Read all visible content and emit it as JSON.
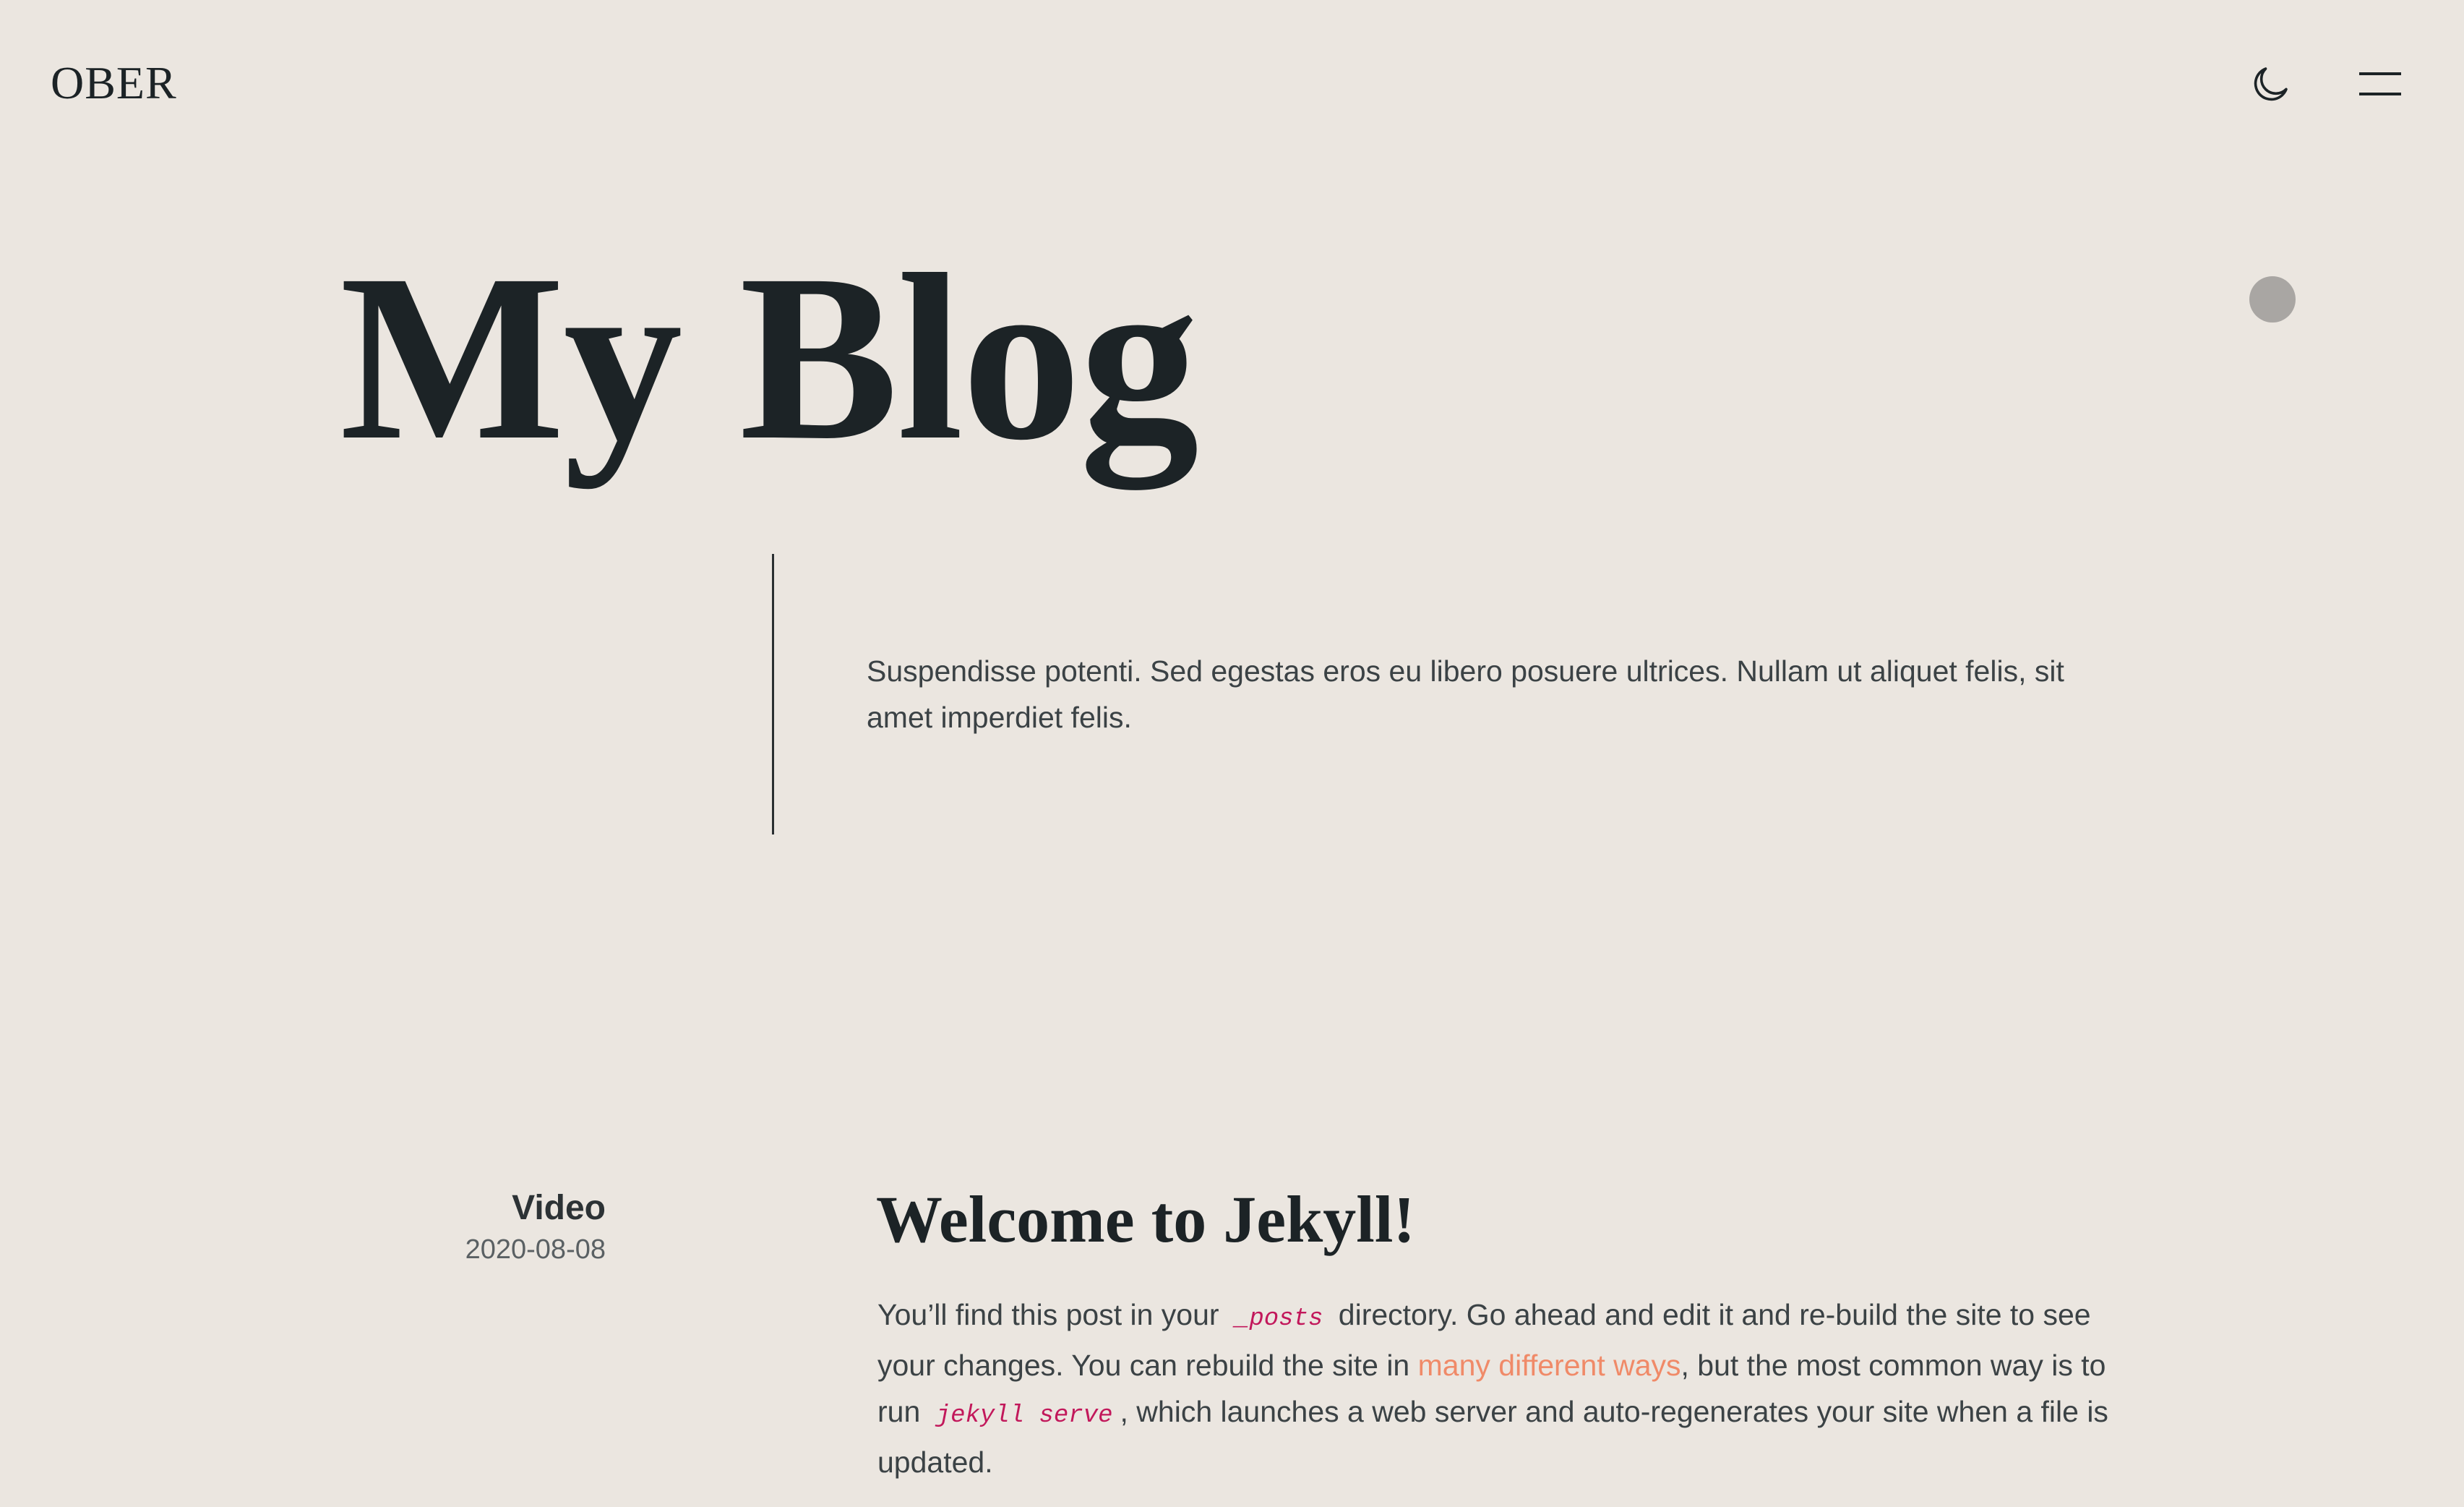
{
  "header": {
    "logo": "OBER",
    "theme_icon": "moon-icon",
    "menu_icon": "hamburger-menu-icon"
  },
  "hero": {
    "title": "My Blog",
    "intro": "Suspendisse potenti. Sed egestas eros eu libero posuere ultrices. Nullam ut aliquet felis, sit amet imperdiet felis."
  },
  "post": {
    "category": "Video",
    "date": "2020-08-08",
    "title": "Welcome to Jekyll!",
    "body": {
      "t1": "You’ll find this post in your",
      "code1": "_posts",
      "t2": "directory. Go ahead and edit it and re-build the site to see your changes. You can rebuild the site in",
      "link": "many different ways",
      "t3": ", but the most common way is to run",
      "code2": "jekyll serve",
      "t4": ", which launches a web server and auto-regenerates your site when a file is updated."
    }
  },
  "colors": {
    "background": "#ebe6e0",
    "text": "#1c2326",
    "link": "#f08a68",
    "code": "#c2185b"
  }
}
